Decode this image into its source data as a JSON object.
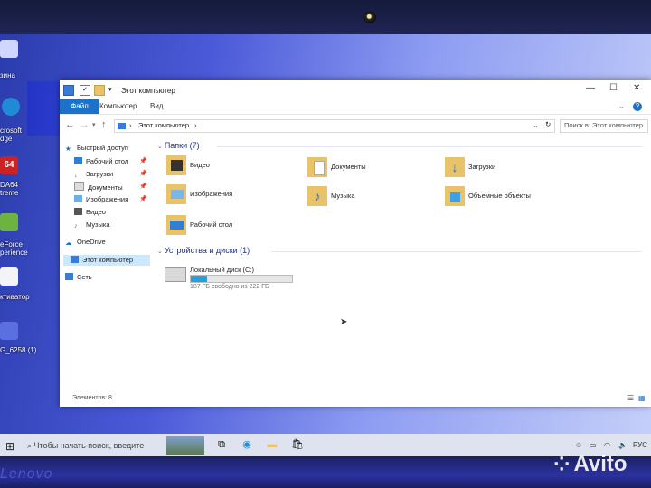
{
  "desktop": {
    "icons": [
      {
        "label": "зина",
        "icon": "recycle-bin-icon"
      },
      {
        "label": "crosoft\ndge",
        "icon": "edge-icon"
      },
      {
        "label": "DA64\ntreme",
        "icon": "aida64-icon"
      },
      {
        "label": "eForce\nperience",
        "icon": "geforce-icon"
      },
      {
        "label": "ктиватор",
        "icon": "file-icon"
      },
      {
        "label": "G_6258 (1)",
        "icon": "file-icon"
      }
    ]
  },
  "window": {
    "title": "Этот компьютер",
    "ribbon_tabs": [
      "Файл",
      "Компьютер",
      "Вид"
    ],
    "address": "Этот компьютер",
    "search_placeholder": "Поиск в: Этот компьютер",
    "nav": {
      "quick_access": "Быстрый доступ",
      "quick_items": [
        "Рабочий стол",
        "Загрузки",
        "Документы",
        "Изображения",
        "Видео",
        "Музыка"
      ],
      "onedrive": "OneDrive",
      "this_pc": "Этот компьютер",
      "network": "Сеть"
    },
    "folders_header": "Папки (7)",
    "folders": [
      "Видео",
      "Документы",
      "Загрузки",
      "Изображения",
      "Музыка",
      "Объемные объекты",
      "Рабочий стол"
    ],
    "devices_header": "Устройства и диски (1)",
    "drive": {
      "name": "Локальный диск (C:)",
      "free_text": "187 ГБ свободно из 222 ГБ",
      "used_fraction": 0.16
    },
    "status": "Элементов: 8"
  },
  "taskbar": {
    "search_placeholder": "Чтобы начать поиск, введите",
    "lang": "РУС"
  },
  "bezel": {
    "brand": "Lenovo",
    "watermark": "Avito"
  },
  "colors": {
    "accent": "#1a73c9",
    "selection": "#cce8ff",
    "folder": "#e8c36a",
    "drive_fill": "#26a0da",
    "desktop_blue": "#3a4bd0"
  }
}
